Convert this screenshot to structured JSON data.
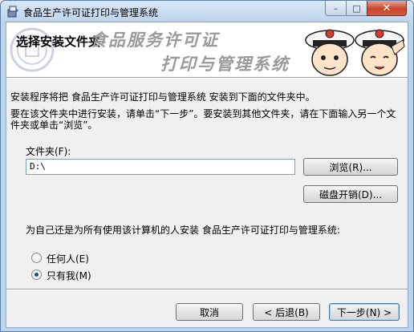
{
  "window": {
    "title": "食品生产许可证打印与管理系统",
    "controls": {
      "minimize": "–",
      "maximize": "□",
      "close": "✕"
    }
  },
  "banner": {
    "heading": "选择安装文件夹",
    "slogan_line1": "食品服务许可证",
    "slogan_line2": "打印与管理系统"
  },
  "body": {
    "intro": "安装程序将把 食品生产许可证打印与管理系统 安装到下面的文件夹中。",
    "instructions": "要在该文件夹中进行安装，请单击“下一步”。要安装到其他文件夹，请在下面输入另一个文件夹或单击“浏览”。",
    "folder_label": "文件夹(F):",
    "folder_value": "D:\\",
    "browse_label": "浏览(R)...",
    "disk_cost_label": "磁盘开销(D)...",
    "install_for_question": "为自己还是为所有使用该计算机的人安装 食品生产许可证打印与管理系统:",
    "options": [
      {
        "label": "任何人(E)",
        "checked": false
      },
      {
        "label": "只有我(M)",
        "checked": true
      }
    ]
  },
  "footer": {
    "cancel_label": "取消",
    "back_label": "< 后退(B)",
    "next_label": "下一步(N) >"
  }
}
